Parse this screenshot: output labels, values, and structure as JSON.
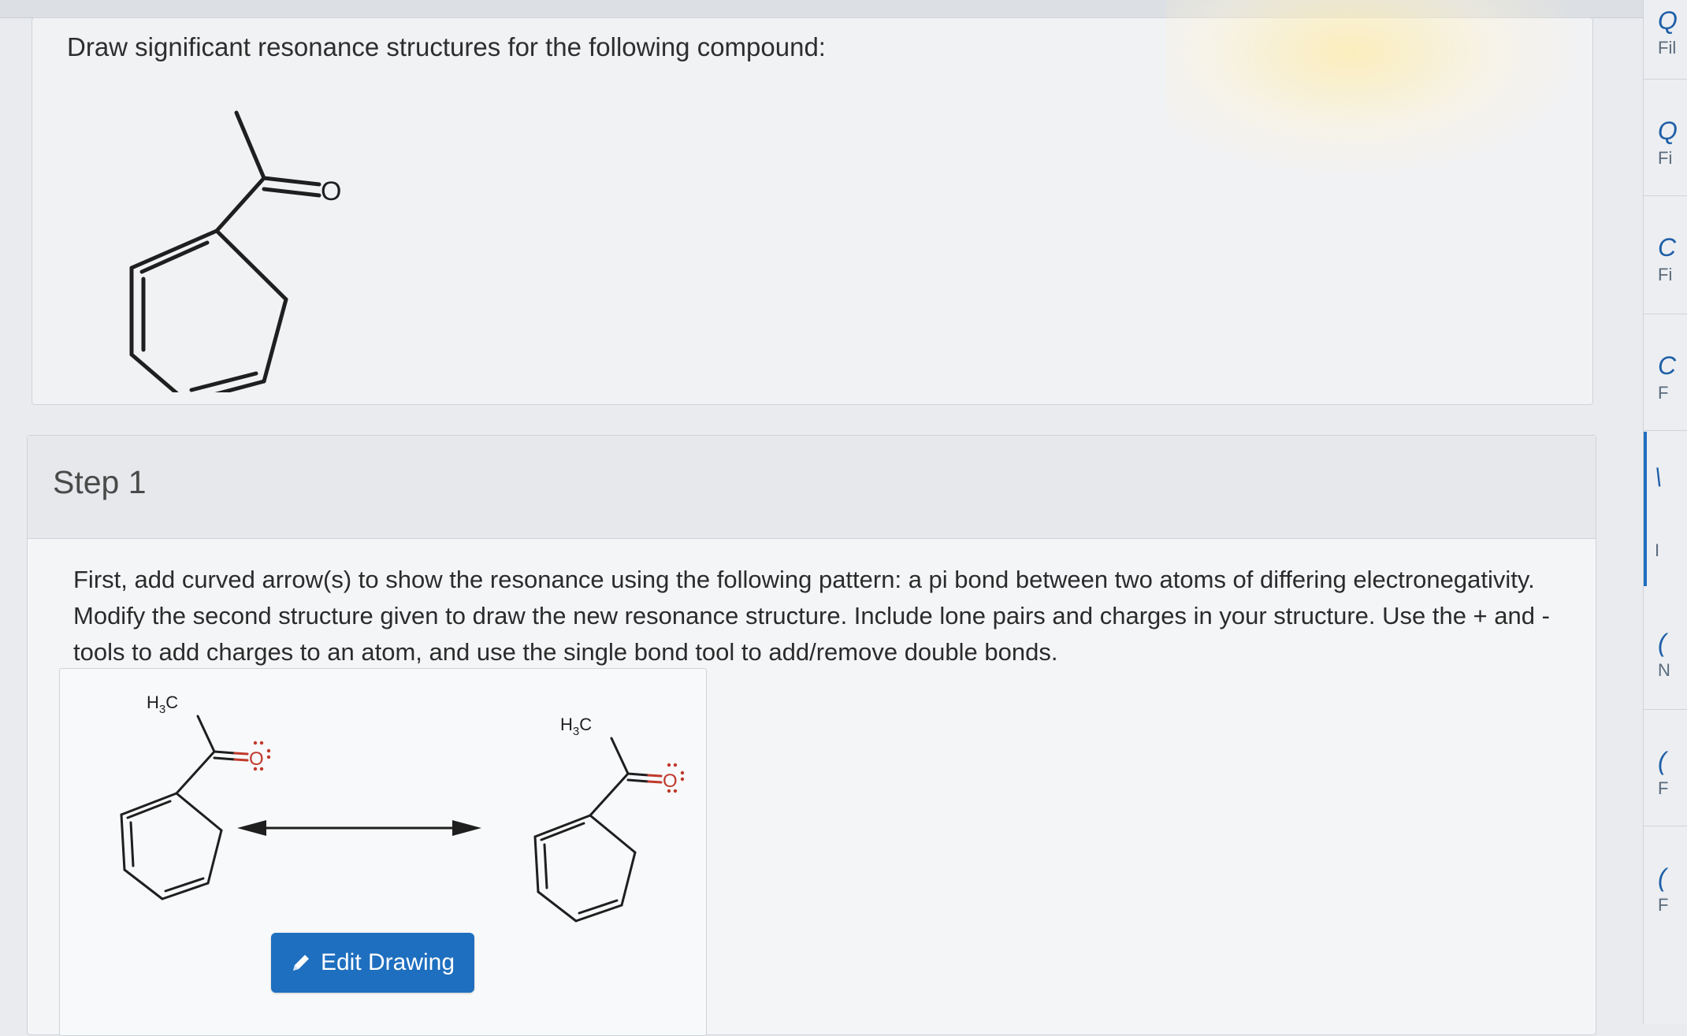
{
  "question": {
    "prompt": "Draw significant resonance structures for the following compound:",
    "oxygen_label": "O"
  },
  "step": {
    "title": "Step 1",
    "instructions": "First, add curved arrow(s) to show the resonance using the following pattern: a pi bond between two atoms of differing electronegativity. Modify the second structure given to draw the new resonance structure. Include lone pairs and charges in your structure. Use the + and - tools to add charges to an atom, and use the single bond tool to add/remove double bonds.",
    "methyl_label_main": "H",
    "methyl_label_sub": "3",
    "methyl_label_end": "C",
    "oxygen_label": "O",
    "edit_button_label": "Edit Drawing"
  },
  "side_panel": {
    "items": [
      {
        "num": "Q",
        "label": "Fil"
      },
      {
        "num": "Q",
        "label": "Fi"
      },
      {
        "num": "C",
        "label": "Fi"
      },
      {
        "num": "C",
        "label": "F"
      },
      {
        "num": "\\",
        "label": "I"
      },
      {
        "num": "(",
        "label": "N"
      },
      {
        "num": "(",
        "label": "F"
      },
      {
        "num": "(",
        "label": "F"
      }
    ]
  },
  "colors": {
    "accent": "#1e6fbf",
    "oxygen_red": "#c0392b",
    "bond": "#1f1f1f"
  }
}
